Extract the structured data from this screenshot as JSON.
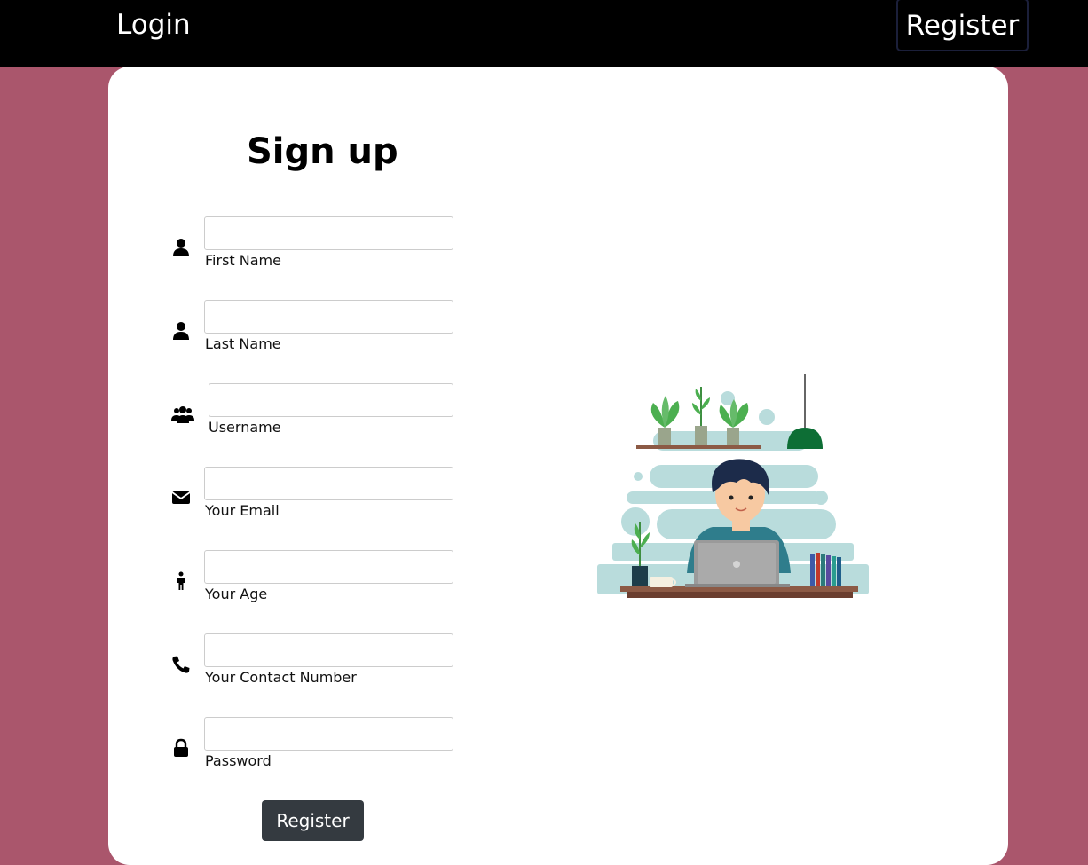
{
  "nav": {
    "login_label": "Login",
    "register_label": "Register"
  },
  "form": {
    "title": "Sign up",
    "fields": [
      {
        "icon": "user-icon",
        "label": "First Name",
        "value": ""
      },
      {
        "icon": "user-icon",
        "label": "Last Name",
        "value": ""
      },
      {
        "icon": "users-icon",
        "label": "Username",
        "value": ""
      },
      {
        "icon": "envelope-icon",
        "label": "Your Email",
        "value": ""
      },
      {
        "icon": "person-standing-icon",
        "label": "Your Age",
        "value": ""
      },
      {
        "icon": "phone-icon",
        "label": "Your Contact Number",
        "value": ""
      },
      {
        "icon": "lock-icon",
        "label": "Password",
        "value": ""
      }
    ],
    "submit_label": "Register"
  },
  "colors": {
    "background": "#aa566c",
    "topbar": "#000000",
    "button": "#343a40"
  },
  "illustration": {
    "icon": "person-working-at-laptop-illustration"
  }
}
